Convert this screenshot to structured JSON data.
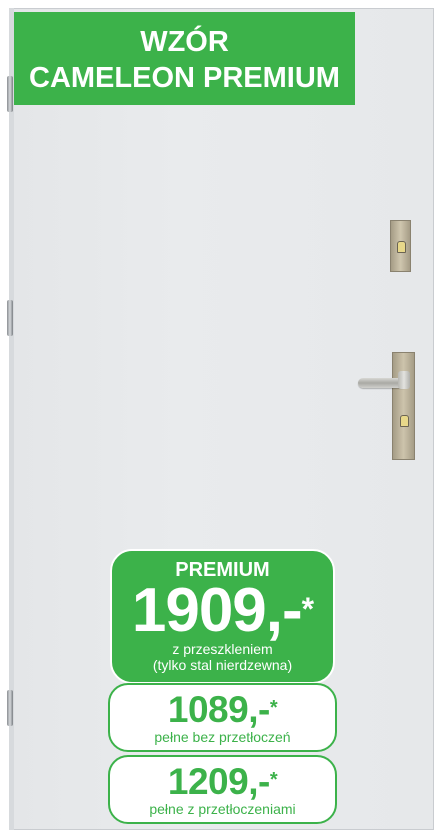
{
  "title": {
    "line1": "WZÓR",
    "line2": "CAMELEON PREMIUM"
  },
  "colors": {
    "accent": "#3cb24a",
    "door": "#e7e9eb"
  },
  "prices": {
    "premium": {
      "label": "PREMIUM",
      "value": "1909,-",
      "asterisk": "*",
      "desc1": "z przeszkleniem",
      "desc2": "(tylko stal nierdzewna)"
    },
    "option1": {
      "value": "1089,-",
      "asterisk": "*",
      "desc": "pełne bez przetłoczeń"
    },
    "option2": {
      "value": "1209,-",
      "asterisk": "*",
      "desc": "pełne z przetłoczeniami"
    }
  }
}
